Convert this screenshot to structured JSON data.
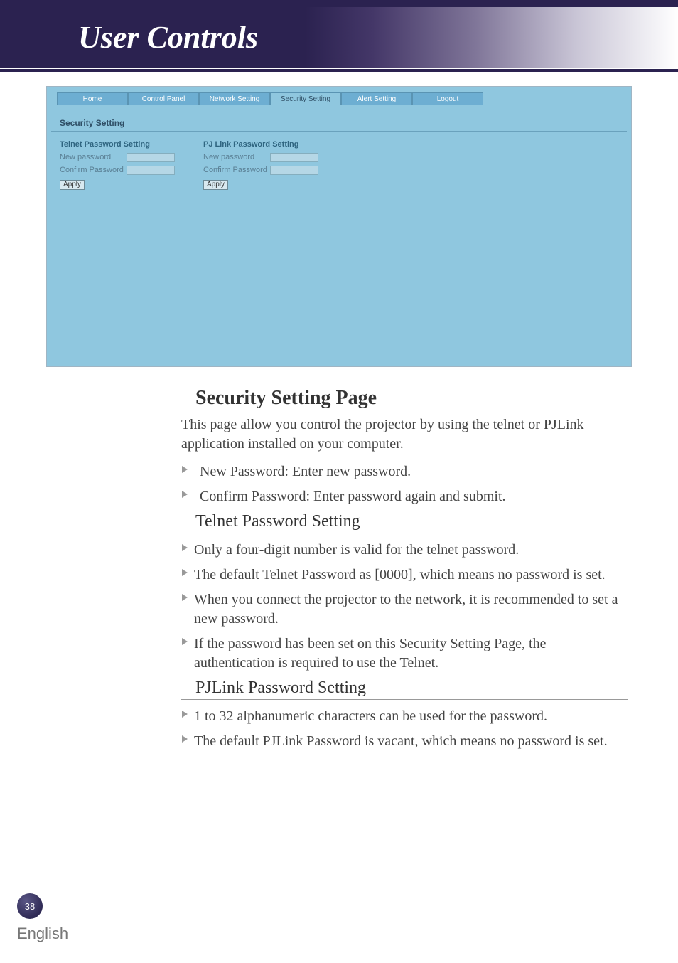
{
  "header": {
    "title": "User Controls"
  },
  "screenshot": {
    "tabs": [
      "Home",
      "Control Panel",
      "Network Setting",
      "Security Setting",
      "Alert Setting",
      "Logout"
    ],
    "active_tab_index": 3,
    "title": "Security Setting",
    "panels": {
      "telnet": {
        "title": "Telnet Password Setting",
        "new_pw": "New password",
        "confirm_pw": "Confirm Password",
        "apply": "Apply"
      },
      "pjlink": {
        "title": "PJ Link Password Setting",
        "new_pw": "New password",
        "confirm_pw": "Confirm Password",
        "apply": "Apply"
      }
    }
  },
  "body": {
    "heading": "Security Setting Page",
    "intro": "This page allow you control the projector by using the telnet or PJLink application installed on your computer.",
    "top_bullets": [
      "New Password: Enter new password.",
      "Confirm Password: Enter password again and submit."
    ],
    "telnet_heading": "Telnet Password Setting",
    "telnet_bullets": [
      "Only a four-digit number is valid for the telnet password.",
      "The default Telnet Password as [0000], which means no password is set.",
      "When you connect the projector to the network, it is recommended to set a new password.",
      "If the password has been set on this Security Setting Page, the authentication is required to use the Telnet."
    ],
    "pjlink_heading": "PJLink Password Setting",
    "pjlink_bullets": [
      "1 to 32 alphanumeric characters can be used for the password.",
      "The default PJLink Password is vacant, which means no password is set."
    ]
  },
  "footer": {
    "page_number": "38",
    "language": "English"
  }
}
